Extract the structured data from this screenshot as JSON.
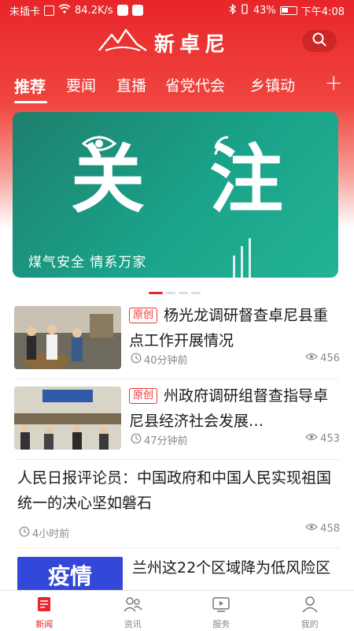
{
  "status_bar": {
    "carrier": "未插卡",
    "speed": "84.2K/s",
    "battery": "43%",
    "time": "下午4:08"
  },
  "brand": {
    "logo_text": "新卓尼"
  },
  "tabs": [
    {
      "label": "推荐",
      "active": true
    },
    {
      "label": "要闻"
    },
    {
      "label": "直播"
    },
    {
      "label": "省党代会"
    },
    {
      "label": "乡镇动"
    }
  ],
  "tab_add": "+",
  "banner": {
    "word1": "关",
    "word2": "注",
    "caption": "煤气安全 情系万家",
    "color": "#1aa38a"
  },
  "carousel": {
    "count": 4,
    "active_index": 0
  },
  "news": [
    {
      "tag": "原创",
      "title": "杨光龙调研督查卓尼县重点工作开展情况",
      "time": "40分钟前",
      "views": "456"
    },
    {
      "tag": "原创",
      "title": "州政府调研组督查指导卓尼县经济社会发展…",
      "time": "47分钟前",
      "views": "453"
    },
    {
      "title": "人民日报评论员：中国政府和中国人民实现祖国统一的决心坚如磐石",
      "time": "4小时前",
      "views": "458"
    },
    {
      "badge": "疫情",
      "title": "兰州这22个区域降为低风险区"
    }
  ],
  "bottom_nav": [
    {
      "label": "新闻",
      "icon": "news-icon",
      "active": true
    },
    {
      "label": "资讯",
      "icon": "people-icon"
    },
    {
      "label": "服务",
      "icon": "video-icon"
    },
    {
      "label": "我的",
      "icon": "user-icon"
    }
  ],
  "colors": {
    "brand_red": "#e8262a",
    "tag_red": "#e33333",
    "badge_blue": "#3348d8"
  }
}
